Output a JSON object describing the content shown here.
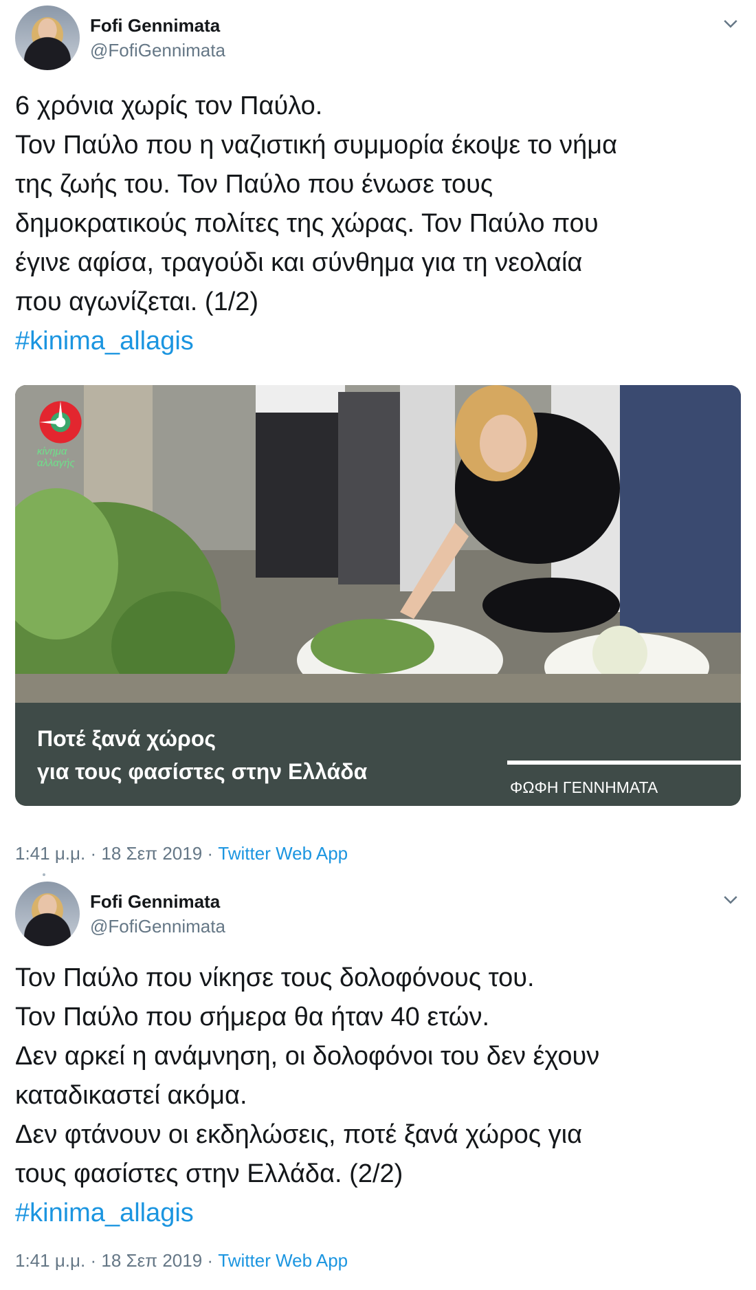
{
  "tweets": [
    {
      "author_name": "Fofi Gennimata",
      "author_handle": "@FofiGennimata",
      "text_lines": [
        "6 χρόνια χωρίς τον Παύλο.",
        "Τον Παύλο που η ναζιστική συμμορία έκοψε το νήμα",
        "της ζωής του. Τον Παύλο που ένωσε τους",
        "δημοκρατικούς πολίτες της χώρας. Τον Παύλο που",
        "έγινε αφίσα, τραγούδι και σύνθημα για τη νεολαία",
        "που αγωνίζεται. (1/2)"
      ],
      "hashtag": "#kinima_allagis",
      "media": {
        "logo_text": "κίνημα αλλαγής",
        "banner_line1": "Ποτέ ξανά χώρος",
        "banner_line2": "για τους φασίστες στην Ελλάδα",
        "banner_signature": "ΦΩΦΗ ΓΕΝΝΗΜΑΤΑ"
      },
      "time": "1:41 μ.μ.",
      "date": "18 Σεπ 2019",
      "app": "Twitter Web App",
      "separator": " · "
    },
    {
      "author_name": "Fofi Gennimata",
      "author_handle": "@FofiGennimata",
      "text_lines": [
        "Τον Παύλο που νίκησε τους δολοφόνους του.",
        "Τον Παύλο που σήμερα θα ήταν 40 ετών.",
        "Δεν αρκεί η ανάμνηση, οι δολοφόνοι του δεν έχουν",
        "καταδικαστεί ακόμα.",
        "Δεν φτάνουν οι εκδηλώσεις, ποτέ ξανά χώρος για",
        "τους φασίστες στην Ελλάδα. (2/2)"
      ],
      "hashtag": "#kinima_allagis",
      "time": "1:41 μ.μ.",
      "date": "18 Σεπ 2019",
      "app": "Twitter Web App",
      "separator": " · "
    }
  ],
  "icons": {
    "menu": "chevron-down-icon",
    "avatar": "avatar"
  },
  "colors": {
    "link": "#1b95e0",
    "muted": "#657786",
    "banner": "#3f4b48",
    "logo_green": "#6ee08a",
    "logo_red": "#e3262f"
  }
}
